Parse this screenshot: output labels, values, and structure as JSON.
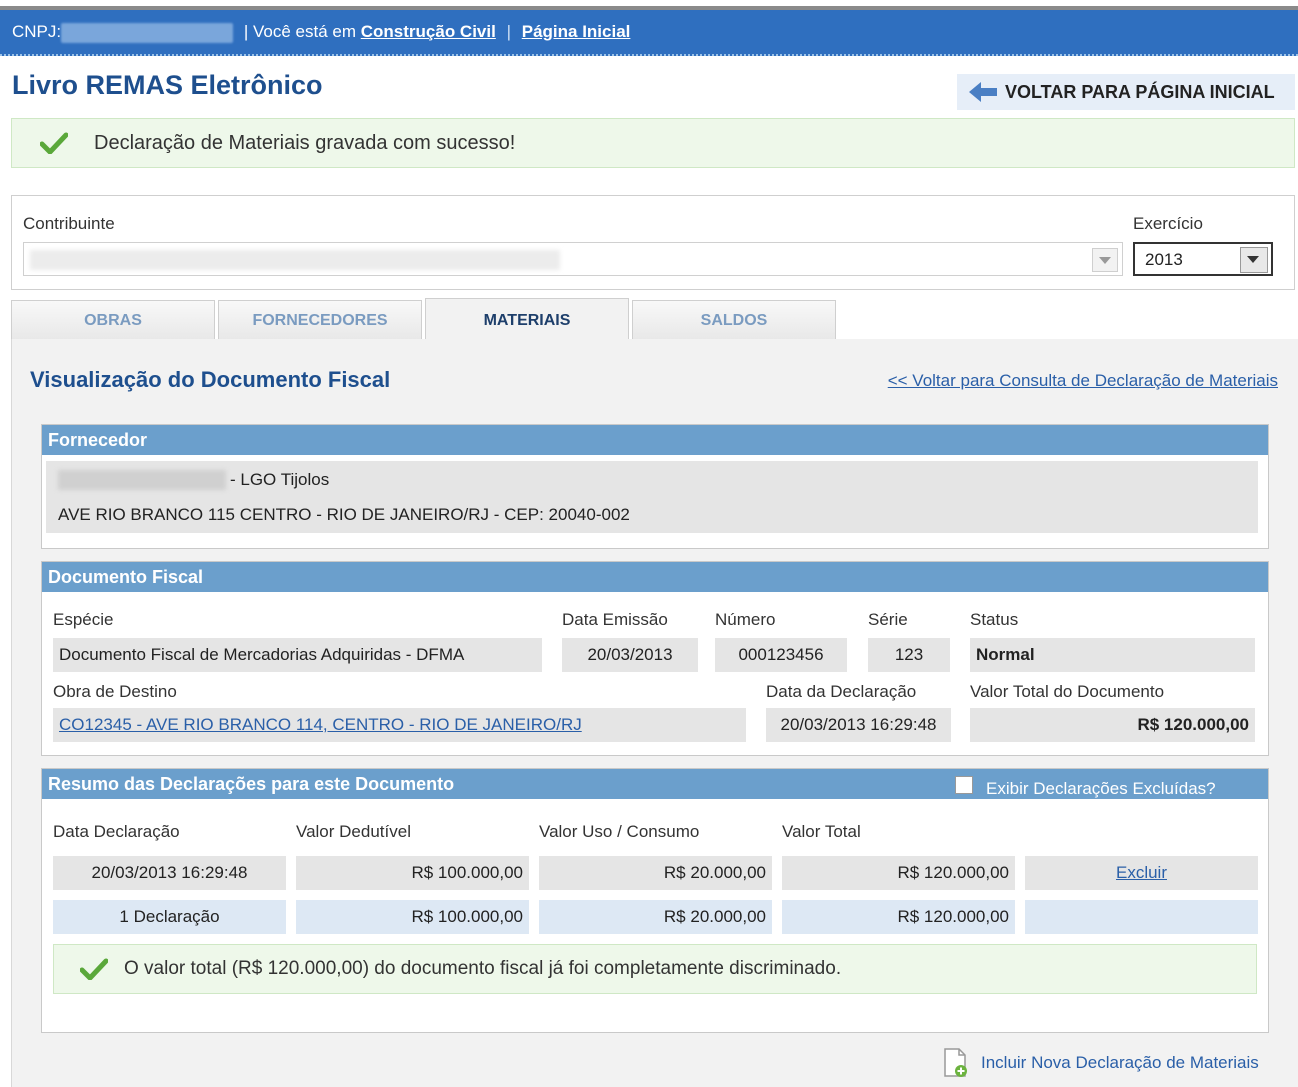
{
  "topbar": {
    "cnpj_label": "CNPJ:",
    "location_prefix": "| Você está em",
    "crumb_1": "Construção Civil",
    "separator": "|",
    "crumb_2": "Página Inicial"
  },
  "page": {
    "title": "Livro REMAS Eletrônico",
    "back_button": "VOLTAR PARA PÁGINA INICIAL",
    "success_message": "Declaração de Materiais gravada com sucesso!"
  },
  "filters": {
    "contribuinte_label": "Contribuinte",
    "exercicio_label": "Exercício",
    "exercicio_value": "2013"
  },
  "tabs": [
    {
      "label": "OBRAS"
    },
    {
      "label": "FORNECEDORES"
    },
    {
      "label": "MATERIAIS"
    },
    {
      "label": "SALDOS"
    }
  ],
  "panel": {
    "title": "Visualização do Documento Fiscal",
    "back_link": "<< Voltar para Consulta de Declaração de Materiais"
  },
  "fornecedor": {
    "header": "Fornecedor",
    "name_suffix": "- LGO Tijolos",
    "address": "AVE RIO BRANCO 115 CENTRO - RIO DE JANEIRO/RJ - CEP: 20040-002"
  },
  "documento": {
    "header": "Documento Fiscal",
    "especie_label": "Espécie",
    "especie_value": "Documento Fiscal de Mercadorias Adquiridas - DFMA",
    "data_emissao_label": "Data Emissão",
    "data_emissao_value": "20/03/2013",
    "numero_label": "Número",
    "numero_value": "000123456",
    "serie_label": "Série",
    "serie_value": "123",
    "status_label": "Status",
    "status_value": "Normal",
    "obra_label": "Obra de Destino",
    "obra_value": "CO12345 - AVE RIO BRANCO 114, CENTRO - RIO DE JANEIRO/RJ",
    "data_declaracao_label": "Data da Declaração",
    "data_declaracao_value": "20/03/2013 16:29:48",
    "valor_total_label": "Valor Total do Documento",
    "valor_total_value": "R$ 120.000,00"
  },
  "resumo": {
    "header": "Resumo das Declarações para este Documento",
    "checkbox_label": "Exibir Declarações Excluídas?",
    "columns": [
      "Data Declaração",
      "Valor Dedutível",
      "Valor Uso / Consumo",
      "Valor Total"
    ],
    "rows": [
      {
        "data": "20/03/2013 16:29:48",
        "dedutivel": "R$ 100.000,00",
        "uso": "R$ 20.000,00",
        "total": "R$ 120.000,00",
        "action": "Excluir"
      }
    ],
    "summary": {
      "data": "1 Declaração",
      "dedutivel": "R$ 100.000,00",
      "uso": "R$ 20.000,00",
      "total": "R$ 120.000,00"
    },
    "ok_message": "O valor total (R$ 120.000,00) do documento fiscal já foi completamente discriminado."
  },
  "footer": {
    "add_link": "Incluir Nova Declaração de Materiais"
  }
}
